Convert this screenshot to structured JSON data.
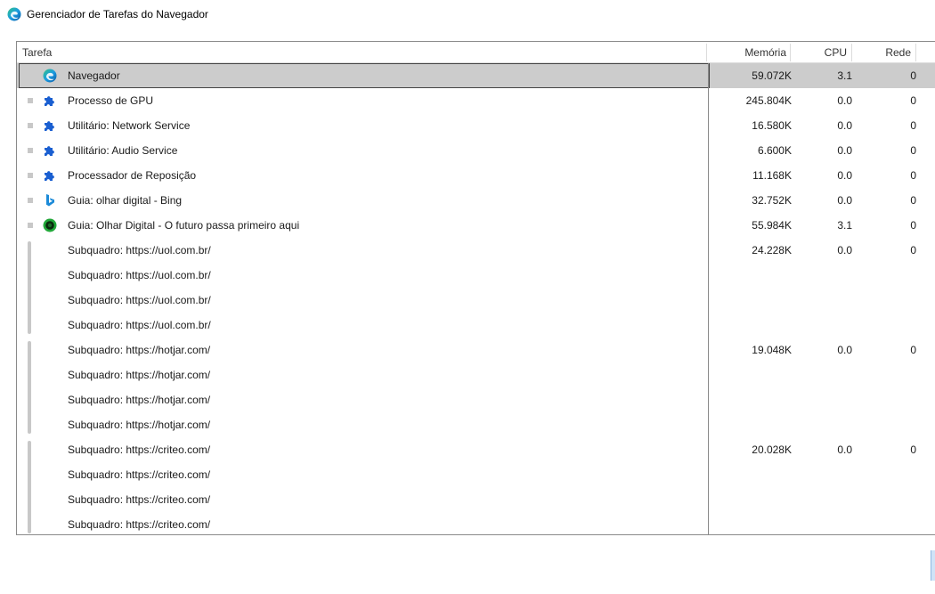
{
  "window": {
    "title": "Gerenciador de Tarefas do Navegador",
    "app_icon": "edge-icon"
  },
  "columns": {
    "task": "Tarefa",
    "memory": "Memória",
    "cpu": "CPU",
    "network": "Rede"
  },
  "rows": [
    {
      "icon": "edge-icon",
      "task": "Navegador",
      "memory": "59.072K",
      "cpu": "3.1",
      "network": "0"
    },
    {
      "icon": "puzzle-icon",
      "task": "Processo de GPU",
      "memory": "245.804K",
      "cpu": "0.0",
      "network": "0"
    },
    {
      "icon": "puzzle-icon",
      "task": "Utilitário: Network Service",
      "memory": "16.580K",
      "cpu": "0.0",
      "network": "0"
    },
    {
      "icon": "puzzle-icon",
      "task": "Utilitário: Audio Service",
      "memory": "6.600K",
      "cpu": "0.0",
      "network": "0"
    },
    {
      "icon": "puzzle-icon",
      "task": "Processador de Reposição",
      "memory": "11.168K",
      "cpu": "0.0",
      "network": "0"
    },
    {
      "icon": "bing-icon",
      "task": "Guia: olhar digital - Bing",
      "memory": "32.752K",
      "cpu": "0.0",
      "network": "0"
    },
    {
      "icon": "olhar-digital-icon",
      "task": "Guia: Olhar Digital - O futuro passa primeiro aqui",
      "memory": "55.984K",
      "cpu": "3.1",
      "network": "0"
    },
    {
      "icon": "",
      "task": "Subquadro: https://uol.com.br/",
      "memory": "24.228K",
      "cpu": "0.0",
      "network": "0"
    },
    {
      "icon": "",
      "task": "Subquadro: https://uol.com.br/",
      "memory": "",
      "cpu": "",
      "network": ""
    },
    {
      "icon": "",
      "task": "Subquadro: https://uol.com.br/",
      "memory": "",
      "cpu": "",
      "network": ""
    },
    {
      "icon": "",
      "task": "Subquadro: https://uol.com.br/",
      "memory": "",
      "cpu": "",
      "network": ""
    },
    {
      "icon": "",
      "task": "Subquadro: https://hotjar.com/",
      "memory": "19.048K",
      "cpu": "0.0",
      "network": "0"
    },
    {
      "icon": "",
      "task": "Subquadro: https://hotjar.com/",
      "memory": "",
      "cpu": "",
      "network": ""
    },
    {
      "icon": "",
      "task": "Subquadro: https://hotjar.com/",
      "memory": "",
      "cpu": "",
      "network": ""
    },
    {
      "icon": "",
      "task": "Subquadro: https://hotjar.com/",
      "memory": "",
      "cpu": "",
      "network": ""
    },
    {
      "icon": "",
      "task": "Subquadro: https://criteo.com/",
      "memory": "20.028K",
      "cpu": "0.0",
      "network": "0"
    },
    {
      "icon": "",
      "task": "Subquadro: https://criteo.com/",
      "memory": "",
      "cpu": "",
      "network": ""
    },
    {
      "icon": "",
      "task": "Subquadro: https://criteo.com/",
      "memory": "",
      "cpu": "",
      "network": ""
    },
    {
      "icon": "",
      "task": "Subquadro: https://criteo.com/",
      "memory": "",
      "cpu": "",
      "network": ""
    }
  ],
  "selected_row": 0,
  "colors": {
    "selected_bg": "#cccccc",
    "puzzle": "#1a5fd1",
    "bing": "#1b8ad8"
  }
}
